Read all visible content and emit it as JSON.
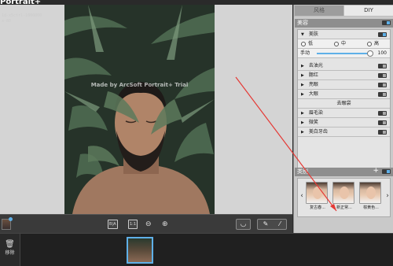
{
  "app": {
    "title": "Portrait+"
  },
  "info_text": [
    "1d-x5ctrl-1000000",
    "x-80"
  ],
  "canvas": {
    "watermark": "Made by ArcSoft Portrait+ Trial"
  },
  "canvas_toolbar": {
    "compare_label": "B|A",
    "fit_label": "1:1",
    "zoom_out_icon": "zoom-out-icon",
    "zoom_in_icon": "zoom-in-icon",
    "smile_icon": "smile-icon",
    "eraser_icon": "eraser-icon",
    "brush_icon": "brush-icon"
  },
  "right_panel": {
    "tabs": [
      {
        "label": "风格"
      },
      {
        "label": "DIY"
      }
    ],
    "beauty_header": "美容",
    "skin_label": "美肤",
    "radio_options": [
      "低",
      "中",
      "高"
    ],
    "manual_label": "手动",
    "manual_value": "100",
    "items": [
      {
        "label": "去油光"
      },
      {
        "label": "腮红"
      },
      {
        "label": "亮眼"
      },
      {
        "label": "大眼"
      },
      {
        "label": "去眼袋"
      },
      {
        "label": "眉毛染"
      },
      {
        "label": "微笑"
      },
      {
        "label": "美白牙齿"
      }
    ],
    "category_header": "类别",
    "presets": [
      {
        "label": "复古春..."
      },
      {
        "label": "新正常..."
      },
      {
        "label": "棕黄色..."
      }
    ]
  },
  "filmstrip": {
    "remove_label": "移除"
  },
  "colors": {
    "accent": "#5fb0e8",
    "annotation": "#e53935"
  }
}
